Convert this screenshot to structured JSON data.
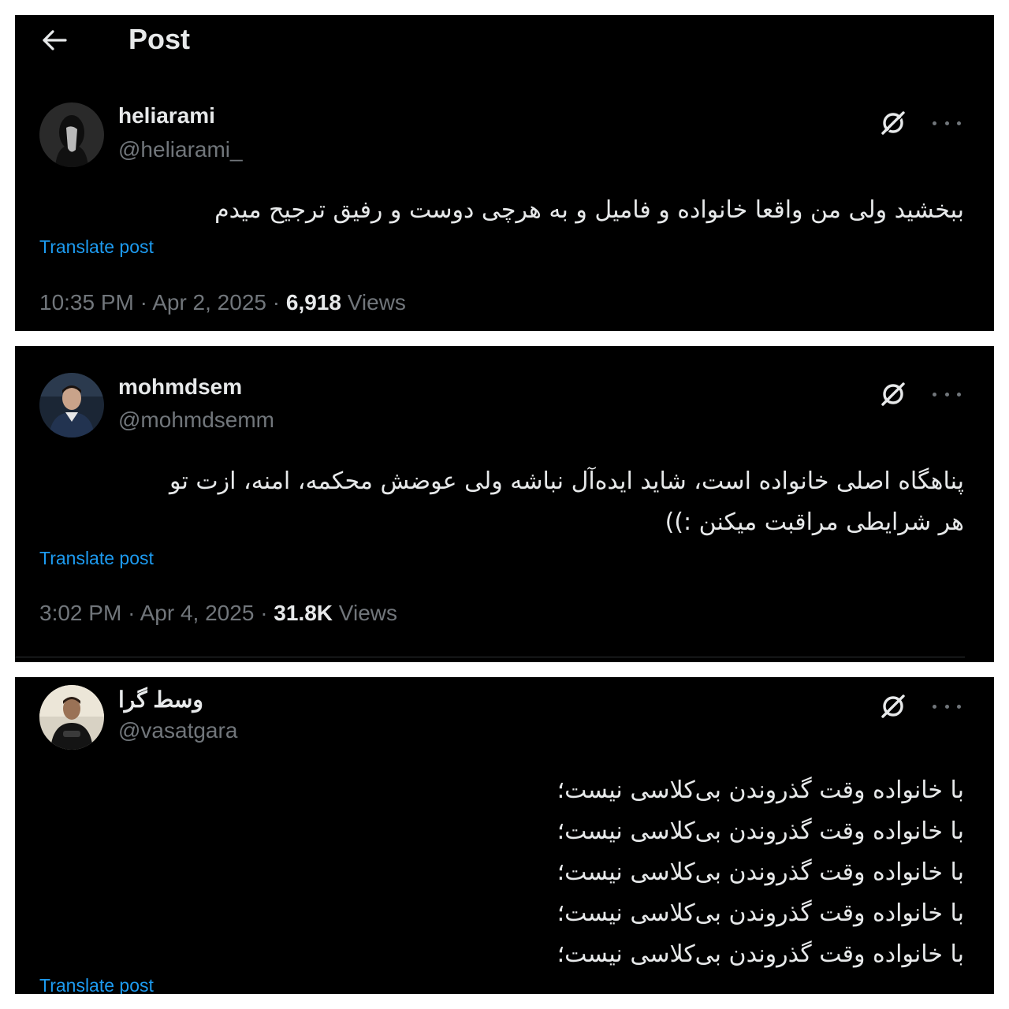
{
  "header": {
    "title": "Post"
  },
  "posts": [
    {
      "display_name": "heliarami",
      "handle": "@heliarami_",
      "text_lines": [
        "ببخشید ولی من واقعا خانواده و فامیل و به هرچی دوست و رفیق ترجیح میدم"
      ],
      "translate_label": "Translate post",
      "time": "10:35 PM",
      "date": "Apr 2, 2025",
      "views_count": "6,918",
      "views_label": "Views"
    },
    {
      "display_name": "mohmdsem",
      "handle": "@mohmdsemm",
      "text_lines": [
        "پناهگاه اصلی خانواده است، شاید ایده‌آل نباشه ولی عوضش محکمه، امنه، ازت تو",
        "هر شرایطی مراقبت میکنن :))"
      ],
      "translate_label": "Translate post",
      "time": "3:02 PM",
      "date": "Apr 4, 2025",
      "views_count": "31.8K",
      "views_label": "Views"
    },
    {
      "display_name": "وسط گرا",
      "handle": "@vasatgara",
      "text_lines": [
        "با خانواده وقت گذروندن بی‌کلاسی نیست؛",
        "با خانواده وقت گذروندن بی‌کلاسی نیست؛",
        "با خانواده وقت گذروندن بی‌کلاسی نیست؛",
        "با خانواده وقت گذروندن بی‌کلاسی نیست؛",
        "با خانواده وقت گذروندن بی‌کلاسی نیست؛"
      ],
      "translate_label": "Translate post"
    }
  ],
  "icons": {
    "back": "back-arrow-icon",
    "grok": "grok-icon",
    "more": "more-options-icon"
  },
  "colors": {
    "background": "#000000",
    "text": "#e7e9ea",
    "secondary_text": "#71767b",
    "link": "#1d9bf0",
    "divider": "#2f3336"
  }
}
